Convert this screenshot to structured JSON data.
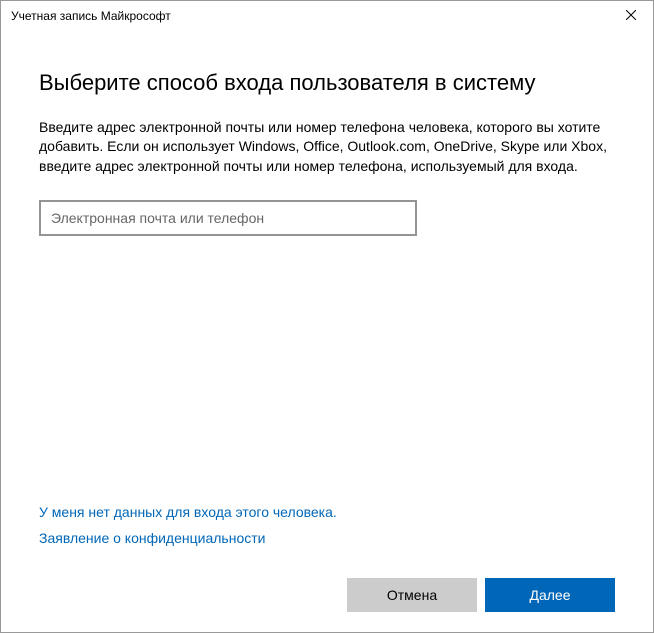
{
  "titlebar": {
    "title": "Учетная запись Майкрософт"
  },
  "content": {
    "heading": "Выберите способ входа пользователя в систему",
    "description": "Введите адрес электронной почты или номер телефона человека, которого вы хотите добавить. Если он использует Windows, Office, Outlook.com, OneDrive, Skype или Xbox, введите адрес электронной почты или номер телефона, используемый для входа.",
    "input_placeholder": "Электронная почта или телефон",
    "input_value": ""
  },
  "links": {
    "no_sign_in": "У меня нет данных для входа этого человека.",
    "privacy": "Заявление о конфиденциальности"
  },
  "buttons": {
    "cancel": "Отмена",
    "next": "Далее"
  }
}
